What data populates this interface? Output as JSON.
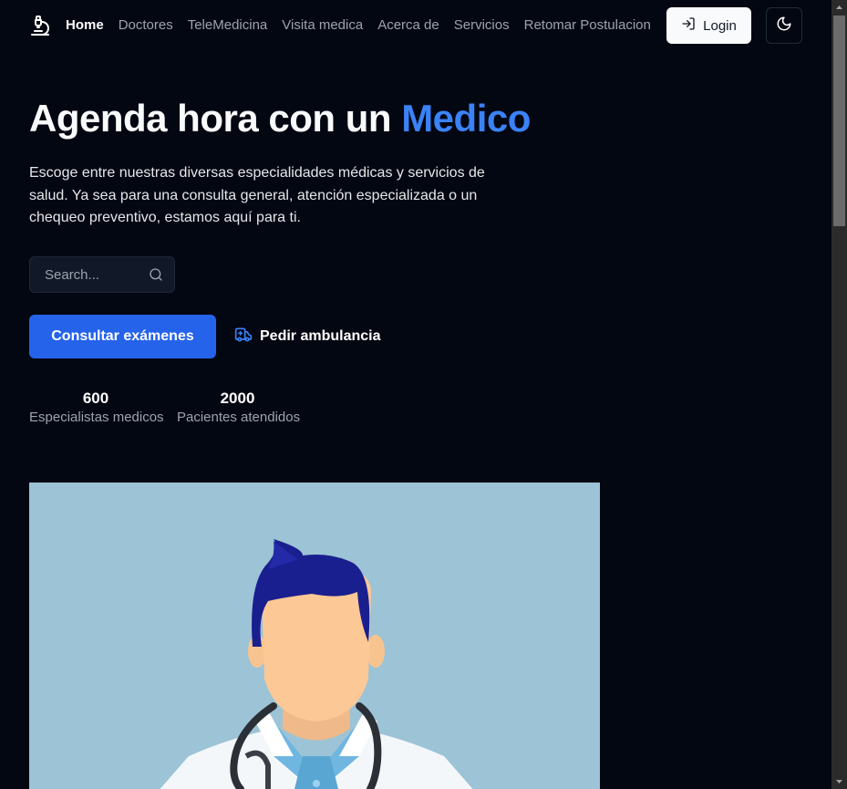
{
  "nav": {
    "links": [
      {
        "label": "Home",
        "active": true
      },
      {
        "label": "Doctores"
      },
      {
        "label": "TeleMedicina"
      },
      {
        "label": "Visita medica"
      },
      {
        "label": "Acerca de"
      },
      {
        "label": "Servicios"
      },
      {
        "label": "Retomar Postulacion"
      }
    ],
    "login_label": "Login",
    "icons": {
      "logo": "microscope-icon",
      "login": "log-in-icon",
      "theme": "moon-icon"
    }
  },
  "hero": {
    "title_main": "Agenda hora con un ",
    "title_accent": "Medico",
    "description": "Escoge entre nuestras diversas especialidades médicas y servicios de salud. Ya sea para una consulta general, atención especializada o un chequeo preventivo, estamos aquí para ti.",
    "search_placeholder": "Search...",
    "primary_button": "Consultar exámenes",
    "secondary_button": "Pedir ambulancia",
    "stats": [
      {
        "value": "600",
        "label": "Especialistas medicos"
      },
      {
        "value": "2000",
        "label": "Pacientes atendidos"
      }
    ]
  },
  "colors": {
    "background": "#030712",
    "accent": "#3b82f6",
    "primary_button": "#2563eb",
    "illustration_bg": "#9cc3d6"
  }
}
